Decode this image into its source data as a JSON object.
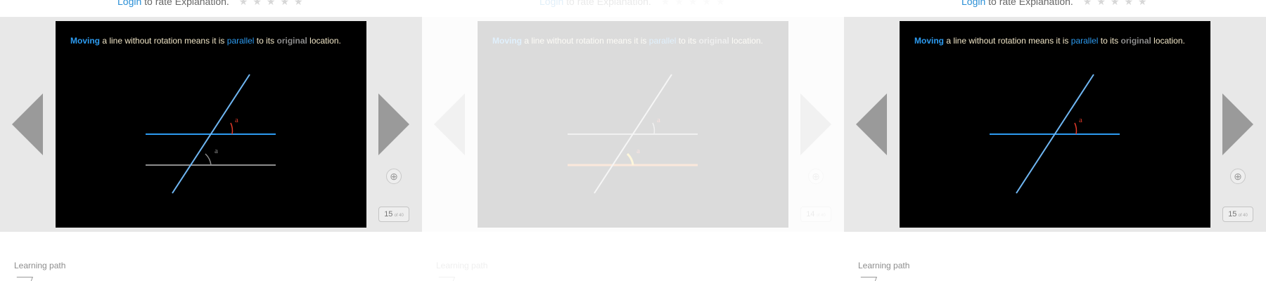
{
  "rating": {
    "login_link": "Login",
    "suffix": " to rate Explanation.",
    "stars": "★★★★★"
  },
  "caption": {
    "w1": "Moving",
    "w2": " a line without rotation means it is ",
    "w3": "parallel",
    "w4": " to its ",
    "w5": "original",
    "w6": " location."
  },
  "angle_label": "a",
  "counter": {
    "panel1": "15",
    "panel2": "14",
    "panel3": "15",
    "unit": "of 40"
  },
  "zoom_symbol": "⊕",
  "learning_path_label": "Learning path",
  "colors": {
    "line_blue": "#2d9bf0",
    "transversal": "#6fb6f2",
    "original_gray": "#8c8c8c",
    "angle_red": "#e23a2a",
    "highlight_orange": "#f28a00",
    "slide_bg": "#000000"
  }
}
